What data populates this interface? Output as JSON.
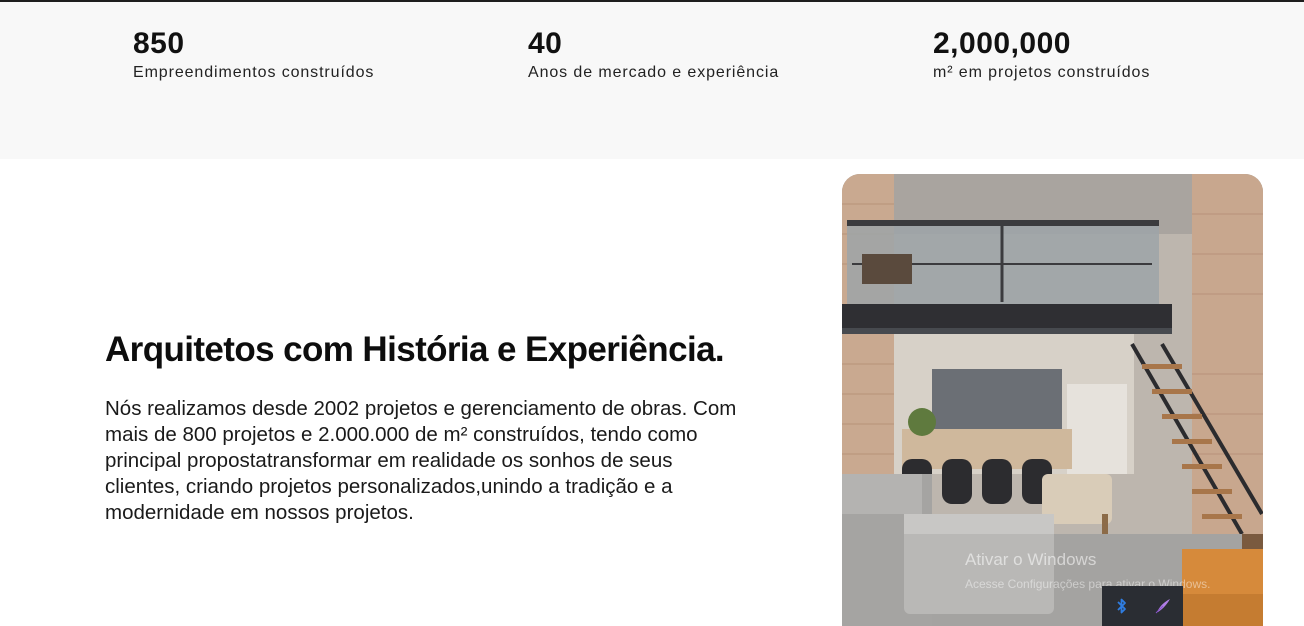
{
  "stats": [
    {
      "value": "850",
      "label": "Empreendimentos construídos"
    },
    {
      "value": "40",
      "label": "Anos de mercado e experiência"
    },
    {
      "value": "2,000,000",
      "label": "m² em projetos construídos"
    }
  ],
  "about": {
    "title": "Arquitetos com História e Experiência.",
    "body": "Nós realizamos desde 2002 projetos e gerenciamento de obras. Com mais de 800 projetos e 2.000.000 de m² construídos, tendo como principal propostatransformar em realidade os sonhos de seus clientes, criando projetos personalizados,unindo a tradição e a modernidade em nossos projetos."
  },
  "photo": {
    "subject": "loft-interior-with-mezzanine"
  },
  "watermark": {
    "title": "Ativar o Windows",
    "subtitle": "Acesse Configurações para ativar o Windows."
  },
  "tray": {
    "icons": [
      "bluetooth-icon",
      "feather-icon"
    ]
  },
  "colors": {
    "stats_background": "#f8f8f8",
    "text": "#111111",
    "tray_background": "#2a2d33",
    "bluetooth": "#2f7de1",
    "feather": "#b07ee6"
  }
}
